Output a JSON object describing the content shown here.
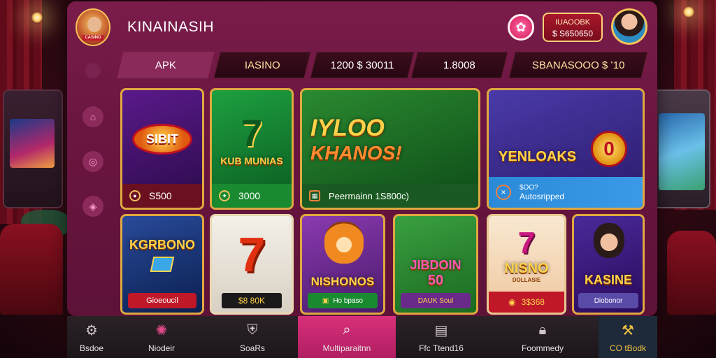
{
  "app": {
    "title": "KINAINASIH",
    "balance_line1": "IUAOOBK",
    "balance_line2": "$ S650650"
  },
  "tabs": [
    {
      "label": "APK"
    },
    {
      "label": "IASINO"
    },
    {
      "label": "1200 $ 30011"
    },
    {
      "label": "1.8008"
    },
    {
      "label": "SBANASOOO $ ʻ10"
    }
  ],
  "cards": [
    {
      "art": "SIBIT",
      "footer": "S500"
    },
    {
      "art": "KUB MUNIAS",
      "footer": "3000"
    },
    {
      "art_line1": "IYLOO",
      "art_line2": "KHANOS!",
      "footer": "Peermainn 1S800c)"
    },
    {
      "art": "YENLOAKS",
      "badge": "0",
      "footer_line1": "$OO?",
      "footer_line2": "Autosripped"
    },
    {
      "art": "KGRBONO",
      "footer": "Gioeoucil"
    },
    {
      "art": "7",
      "footer": "$8 80K"
    },
    {
      "art": "NISHONOS",
      "footer": "Ho bpaso"
    },
    {
      "art_line1": "JIBDOIN",
      "art_line2": "50",
      "footer": "DAUK Soul"
    },
    {
      "art": "NISNO",
      "art_sub": "DOLLASIE",
      "footer": "3$368"
    },
    {
      "art": "KASINE",
      "footer": "Diobonor"
    }
  ],
  "bottom_nav": [
    {
      "label": "Bsdoe",
      "icon": "gear-icon"
    },
    {
      "label": "Niodeir",
      "icon": "settings-icon"
    },
    {
      "label": "SoaRs",
      "icon": "shield-icon"
    },
    {
      "label": "Multiparaitnn",
      "icon": "search-icon"
    },
    {
      "label": "Ffc Ttend16",
      "icon": "book-icon"
    },
    {
      "label": "Foommedy",
      "icon": "lock-icon"
    },
    {
      "label": "CO tBodk",
      "icon": "wand-icon"
    }
  ],
  "colors": {
    "panel": "#6a1640",
    "accent_pink": "#d8307a",
    "gold": "#ffd24a"
  }
}
